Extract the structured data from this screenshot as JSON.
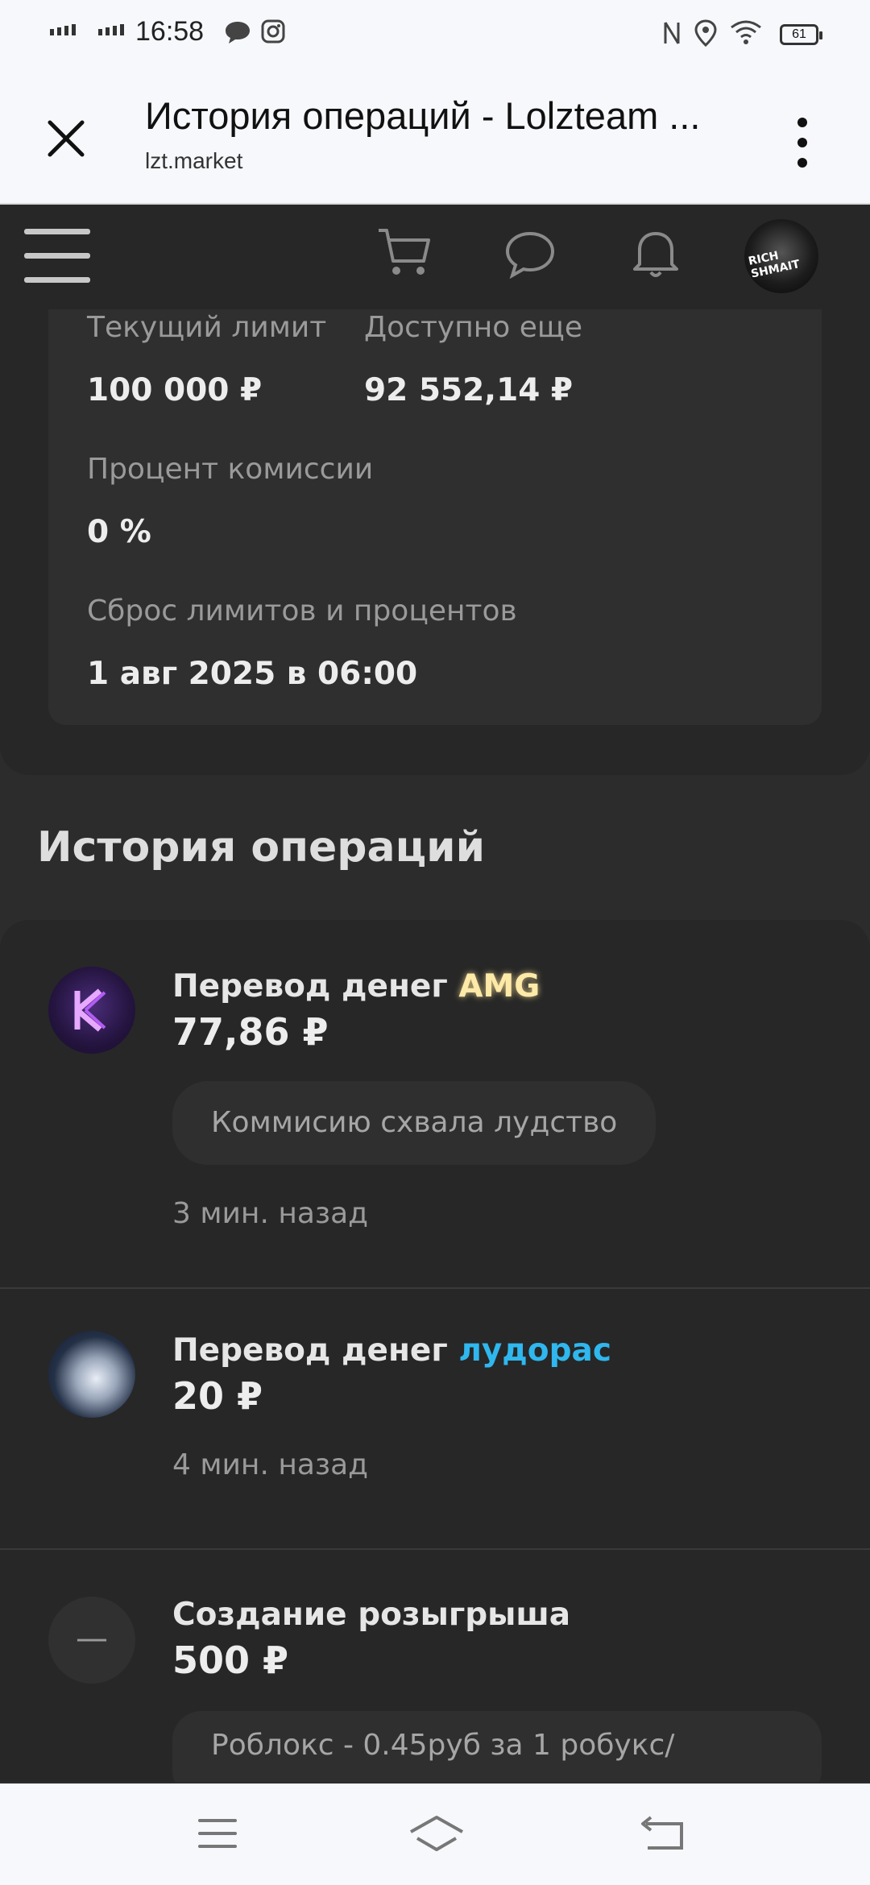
{
  "status": {
    "time": "16:58",
    "battery": "61"
  },
  "browser": {
    "title": "История операций - Lolzteam ...",
    "url": "lzt.market"
  },
  "nav": {
    "avatar_text": "RICH SHMAIT"
  },
  "limits": {
    "current_limit_label": "Текущий лимит",
    "current_limit_value": "100 000 ₽",
    "available_label": "Доступно еще",
    "available_value": "92 552,14 ₽",
    "commission_label": "Процент комиссии",
    "commission_value": "0 %",
    "reset_label": "Сброс лимитов и процентов",
    "reset_value": "1 авг 2025 в 06:00"
  },
  "history": {
    "title": "История операций",
    "items": [
      {
        "prefix": "Перевод денег",
        "user": "AMG",
        "amount": "77,86 ₽",
        "note": "Коммисию схвала лудство",
        "time": "3 мин. назад"
      },
      {
        "prefix": "Перевод денег",
        "user": "лудорас",
        "amount": "20 ₽",
        "time": "4 мин. назад"
      },
      {
        "prefix": "Создание розыгрыша",
        "amount": "500 ₽",
        "note": "Роблокс - 0.45руб за 1 робукс/",
        "avatar_symbol": "—"
      }
    ]
  },
  "colors": {
    "amg": "#fde9a8",
    "ludoras": "#2fb7ee",
    "background": "#2c2c2c"
  }
}
